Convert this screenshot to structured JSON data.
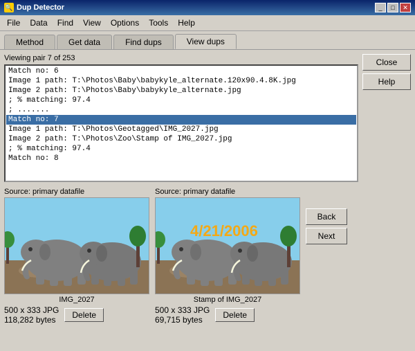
{
  "titleBar": {
    "icon": "🔍",
    "title": "Dup Detector",
    "minimizeLabel": "_",
    "maximizeLabel": "□",
    "closeLabel": "✕"
  },
  "menuBar": {
    "items": [
      "File",
      "Data",
      "Find",
      "View",
      "Options",
      "Tools",
      "Help"
    ]
  },
  "tabs": [
    {
      "label": "Method",
      "active": false
    },
    {
      "label": "Get data",
      "active": false
    },
    {
      "label": "Find dups",
      "active": false
    },
    {
      "label": "View dups",
      "active": true
    }
  ],
  "rightButtons": [
    {
      "label": "Close",
      "name": "close-button"
    },
    {
      "label": "Help",
      "name": "help-button"
    }
  ],
  "viewingLabel": "Viewing pair 7 of 253",
  "listItems": [
    {
      "text": "Match no: 6",
      "selected": false
    },
    {
      "text": "Image 1 path: T:\\Photos\\Baby\\babykyle_alternate.120x90.4.8K.jpg",
      "selected": false
    },
    {
      "text": "Image 2 path: T:\\Photos\\Baby\\babykyle_alternate.jpg",
      "selected": false
    },
    {
      "text": "; % matching: 97.4",
      "selected": false
    },
    {
      "text": "; .......",
      "selected": false
    },
    {
      "text": "Match no: 7",
      "selected": true
    },
    {
      "text": "Image 1 path: T:\\Photos\\Geotagged\\IMG_2027.jpg",
      "selected": false
    },
    {
      "text": "Image 2 path: T:\\Photos\\Zoo\\Stamp of IMG_2027.jpg",
      "selected": false
    },
    {
      "text": "; % matching: 97.4",
      "selected": false
    },
    {
      "text": "Match no: 8",
      "selected": false
    }
  ],
  "image1": {
    "sourceLabel": "Source: primary datafile",
    "filename": "IMG_2027",
    "info": "500 x 333 JPG",
    "bytes": "118,282 bytes",
    "deleteLabel": "Delete"
  },
  "image2": {
    "sourceLabel": "Source: primary datafile",
    "filename": "Stamp of IMG_2027",
    "info": "500 x 333 JPG",
    "bytes": "69,715 bytes",
    "deleteLabel": "Delete",
    "watermarkText": "4/21/2006"
  },
  "navButtons": {
    "backLabel": "Back",
    "nextLabel": "Next"
  }
}
